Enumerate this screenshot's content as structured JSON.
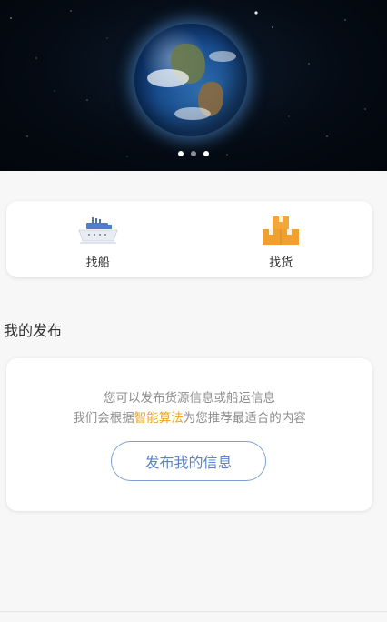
{
  "banner": {
    "image": "earth-in-space",
    "pager": {
      "count": 3,
      "active_index": 2
    }
  },
  "actions": [
    {
      "label": "找船",
      "icon": "ship-icon"
    },
    {
      "label": "找货",
      "icon": "cargo-boxes-icon"
    }
  ],
  "section": {
    "title": "我的发布"
  },
  "publish": {
    "line1": "您可以发布货源信息或船运信息",
    "line2_prefix": "我们会根据",
    "line2_highlight": "智能算法",
    "line2_suffix": "为您推荐最适合的内容",
    "button_label": "发布我的信息"
  },
  "colors": {
    "highlight": "#f0a31b",
    "button_border": "#7d9fd6",
    "button_text": "#5b82c8"
  }
}
